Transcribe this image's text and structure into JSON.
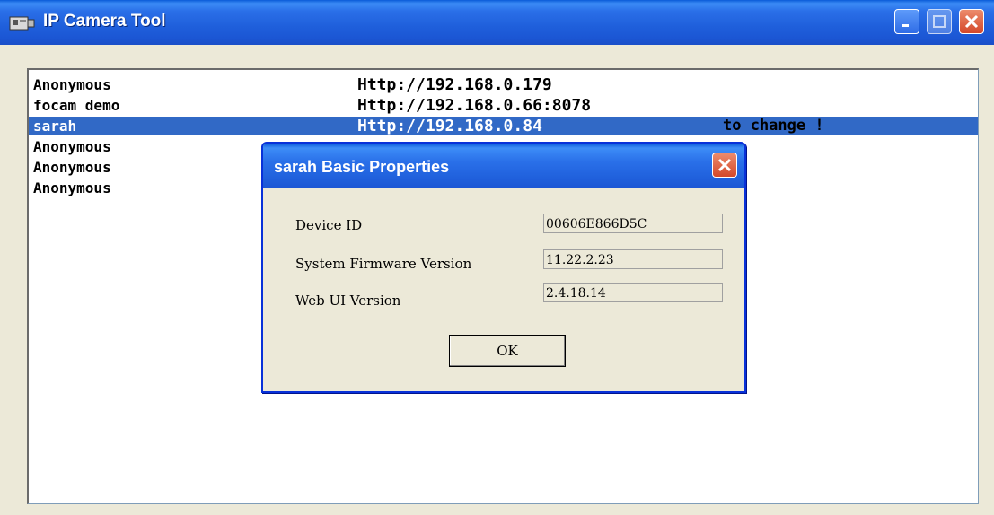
{
  "window": {
    "title": "IP Camera Tool",
    "icon": "camera-app-icon"
  },
  "camera_list": [
    {
      "name": "Anonymous",
      "address": "Http://192.168.0.179",
      "selected": false
    },
    {
      "name": "focam demo",
      "address": "Http://192.168.0.66:8078",
      "selected": false
    },
    {
      "name": "sarah",
      "address": "Http://192.168.0.84",
      "selected": true
    },
    {
      "name": "Anonymous",
      "address": "",
      "selected": false
    },
    {
      "name": "Anonymous",
      "address": "",
      "selected": false
    },
    {
      "name": "Anonymous",
      "address": "",
      "selected": false
    }
  ],
  "partial_text": "to change !",
  "dialog": {
    "title": "sarah Basic Properties",
    "fields": [
      {
        "label": "Device ID",
        "value": "00606E866D5C"
      },
      {
        "label": "System Firmware Version",
        "value": "11.22.2.23"
      },
      {
        "label": "Web UI Version",
        "value": "2.4.18.14"
      }
    ],
    "ok_label": "OK"
  },
  "colors": {
    "titlebar": "#1F5FDB",
    "selection": "#3169C6",
    "window_bg": "#ECE9D8"
  }
}
